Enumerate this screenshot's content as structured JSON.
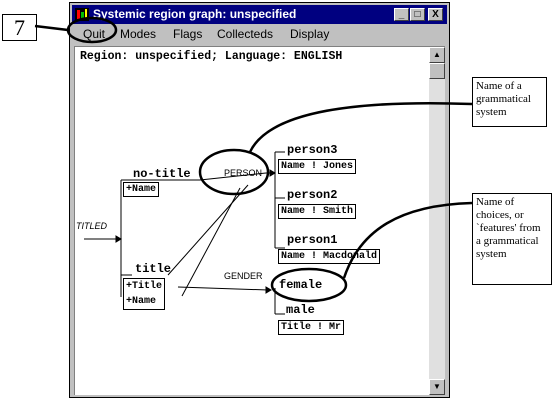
{
  "figure_number": "7",
  "window": {
    "title": "Systemic region graph: unspecified",
    "controls": {
      "minimize": "_",
      "maximize": "□",
      "close": "X"
    }
  },
  "menu": [
    "Quit",
    "Modes",
    "Flags",
    "Collecteds",
    "Display"
  ],
  "region_header": "Region: unspecified; Language: ENGLISH",
  "graph": {
    "entry": "TITLED",
    "features": {
      "no_title": "no-title",
      "title": "title",
      "person3": "person3",
      "person2": "person2",
      "person1": "person1",
      "female": "female",
      "male": "male"
    },
    "systems": {
      "person": "PERSON",
      "gender": "GENDER"
    },
    "realizations": {
      "no_title": [
        "+Name"
      ],
      "title": [
        "+Title",
        "+Name"
      ],
      "person3": "Name ! Jones",
      "person2": "Name ! Smith",
      "person1": "Name ! Macdonald",
      "male": "Title ! Mr"
    }
  },
  "annotations": {
    "system_note": "Name of a grammatical system",
    "features_note": "Name of choices, or `features' from a grammatical system"
  }
}
